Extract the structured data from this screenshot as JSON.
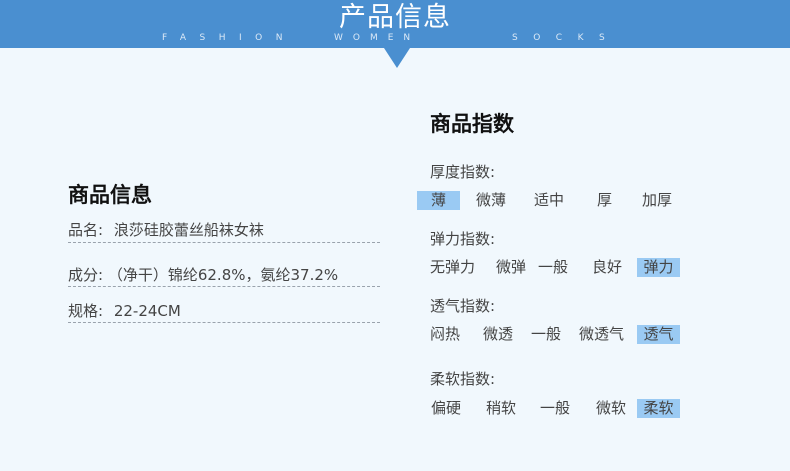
{
  "banner": {
    "title": "产品信息",
    "subtitle_1": "FASHION",
    "subtitle_2": "WOMEN",
    "subtitle_3": "SOCKS"
  },
  "product_info": {
    "title": "商品信息",
    "rows": [
      {
        "label": "品名:",
        "value": "浪莎硅胶蕾丝船袜女袜"
      },
      {
        "label": "成分:",
        "value": "（净干）锦纶62.8%，氨纶37.2%"
      },
      {
        "label": "规格:",
        "value": "22-24CM"
      }
    ]
  },
  "index_section": {
    "title": "商品指数",
    "categories": [
      {
        "label": "厚度指数:",
        "options": [
          "薄",
          "微薄",
          "适中",
          "厚",
          "加厚"
        ],
        "selected": "薄"
      },
      {
        "label": "弹力指数:",
        "options": [
          "无弹力",
          "微弹",
          "一般",
          "良好",
          "弹力"
        ],
        "selected": "弹力"
      },
      {
        "label": "透气指数:",
        "options": [
          "闷热",
          "微透",
          "一般",
          "微透气",
          "透气"
        ],
        "selected": "透气"
      },
      {
        "label": "柔软指数:",
        "options": [
          "偏硬",
          "稍软",
          "一般",
          "微软",
          "柔软"
        ],
        "selected": "柔软"
      }
    ]
  },
  "colors": {
    "banner": "#4a8fd0",
    "highlight": "#9acaf3",
    "background": "#f1f8fd"
  }
}
